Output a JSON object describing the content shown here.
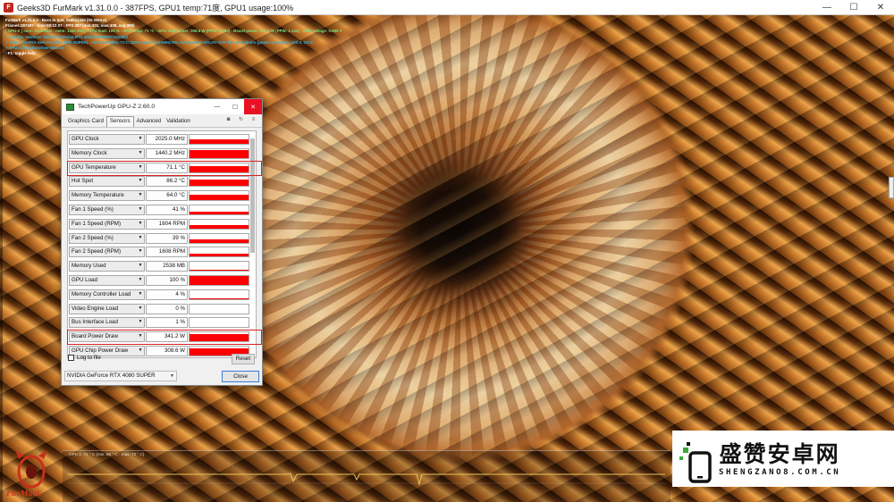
{
  "furmark": {
    "window_title": "Geeks3D FurMark v1.31.0.0 - 387FPS, GPU1 temp:71度, GPU1 usage:100%",
    "controls": {
      "minimize": "—",
      "maximize": "☐",
      "close": "✕"
    },
    "osd_lines": [
      {
        "text": "FurMark v1.31.0.0 - Burn-in test, 2560x1440 (0X MSAA)",
        "color": "#ffffff"
      },
      {
        "text": "Frames:287497 - time:00:12:07 - FPS:387 (min:301, max:408, avg:395)",
        "color": "#ffffff"
      },
      {
        "text": "[ GPU-Z ] core: 2025 MHz - mem: 1440 MHz - GPU load: 100 % - GPU temp: 71 °C - GPU chip power: 308.6 W (PPW: 1.254) - Board power: 341.2 W (PPW: 1.134) - GPU voltage: 0.986 V",
        "color": "#7fe07f"
      },
      {
        "text": "> OpenGL renderer: NVIDIA GeForce RTX 4080 SUPER/PCIe/SSE2",
        "color": "#33b4e0"
      },
      {
        "text": "> GPU 1 (NVIDIA GeForce RTX 4080 SUPER) - core: 2025MHz:71°C:100%, mem: 1440MHz:9%, GPU power: 100.2% TDP, fan: 41%, limits:[power:1, temp:0, volt:0, OV:0]",
        "color": "#33b4e0"
      },
      {
        "text": "> GPU 2 (GraphicDriver Device)",
        "color": "#33b4e0"
      },
      {
        "text": "- F1: toggle help",
        "color": "#ffffff"
      }
    ],
    "monitor_label": "GPU 1: 71 ° C (min: 55 ° C - max: 72 ° C)",
    "logo_text": "FurMark"
  },
  "gpuz": {
    "title": "TechPowerUp GPU-Z 2.60.0",
    "tabs": [
      {
        "label": "Graphics Card",
        "active": false
      },
      {
        "label": "Sensors",
        "active": true
      },
      {
        "label": "Advanced",
        "active": false
      },
      {
        "label": "Validation",
        "active": false
      }
    ],
    "tool_icons": [
      "camera-icon",
      "refresh-icon",
      "menu-icon"
    ],
    "sensors": [
      {
        "name": "GPU Clock",
        "value": "2025.0 MHz",
        "fill": 0.55,
        "highlight": false
      },
      {
        "name": "Memory Clock",
        "value": "1440.2 MHz",
        "fill": 0.9,
        "highlight": false
      },
      {
        "name": "GPU Temperature",
        "value": "71.1 °C",
        "fill": 0.7,
        "highlight": true
      },
      {
        "name": "Hot Spot",
        "value": "86.2 °C",
        "fill": 0.75,
        "highlight": false
      },
      {
        "name": "Memory Temperature",
        "value": "64.0 °C",
        "fill": 0.65,
        "highlight": false
      },
      {
        "name": "Fan 1 Speed (%)",
        "value": "41 %",
        "fill": 0.35,
        "highlight": false
      },
      {
        "name": "Fan 1 Speed (RPM)",
        "value": "1604 RPM",
        "fill": 0.35,
        "highlight": false
      },
      {
        "name": "Fan 2 Speed (%)",
        "value": "39 %",
        "fill": 0.33,
        "highlight": false
      },
      {
        "name": "Fan 2 Speed (RPM)",
        "value": "1608 RPM",
        "fill": 0.35,
        "highlight": false
      },
      {
        "name": "Memory Used",
        "value": "2538 MB",
        "fill": 0.15,
        "highlight": false
      },
      {
        "name": "GPU Load",
        "value": "100 %",
        "fill": 1.0,
        "highlight": false
      },
      {
        "name": "Memory Controller Load",
        "value": "4 %",
        "fill": 0.06,
        "highlight": false
      },
      {
        "name": "Video Engine Load",
        "value": "0 %",
        "fill": 0.0,
        "highlight": false
      },
      {
        "name": "Bus Interface Load",
        "value": "1 %",
        "fill": 0.03,
        "highlight": false
      },
      {
        "name": "Board Power Draw",
        "value": "341.2 W",
        "fill": 0.8,
        "highlight": true
      },
      {
        "name": "GPU Chip Power Draw",
        "value": "308.6 W",
        "fill": 0.8,
        "highlight": false
      }
    ],
    "log_to_file": "Log to file",
    "reset": "Reset",
    "gpu_select": "NVIDIA GeForce RTX 4080 SUPER",
    "close": "Close",
    "controls": {
      "minimize": "—",
      "maximize": "☐",
      "close": "✕"
    }
  },
  "watermark": {
    "title": "盛赞安卓网",
    "url": "SHENGZANO8.COM.CN",
    "accent": "#3aa935"
  }
}
